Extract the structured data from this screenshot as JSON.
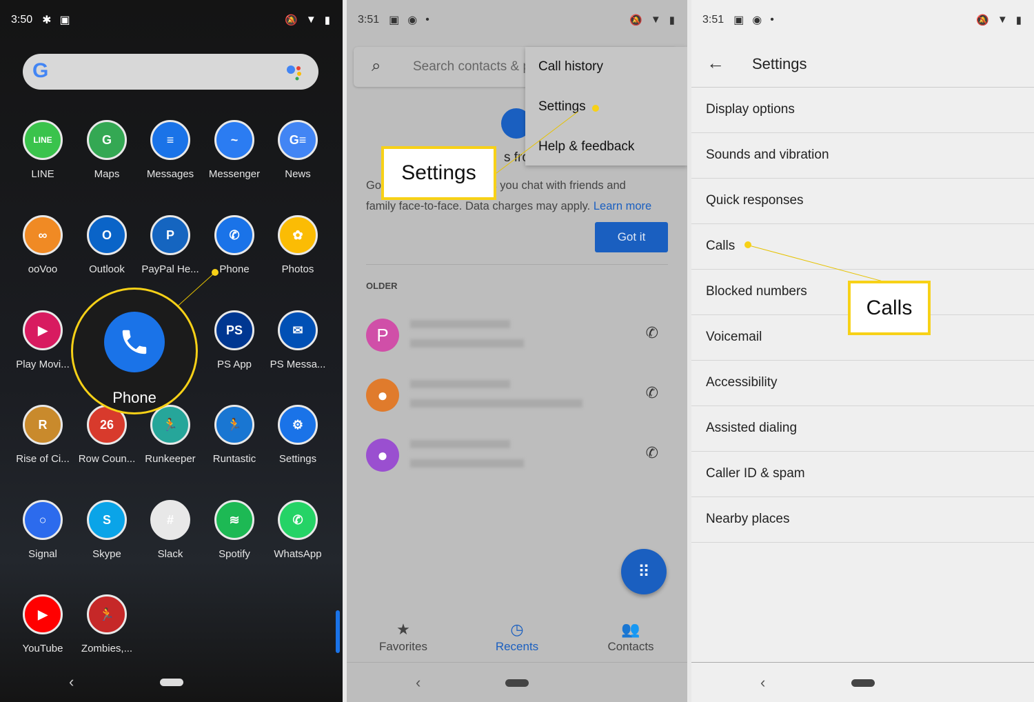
{
  "left": {
    "time": "3:50",
    "status_icons": [
      "slack-icon",
      "screenshot-icon",
      "dnd-off-icon",
      "wifi-icon",
      "battery-icon"
    ],
    "apps": [
      {
        "label": "LINE",
        "color": "#3ac34c",
        "glyph": "LINE"
      },
      {
        "label": "Maps",
        "color": "#34a853",
        "glyph": "G"
      },
      {
        "label": "Messages",
        "color": "#1a73e8",
        "glyph": "≡"
      },
      {
        "label": "Messenger",
        "color": "#2b7cf2",
        "glyph": "~"
      },
      {
        "label": "News",
        "color": "#4285f4",
        "glyph": "G≡"
      },
      {
        "label": "ooVoo",
        "color": "#f08a24",
        "glyph": "∞"
      },
      {
        "label": "Outlook",
        "color": "#0a64c8",
        "glyph": "O"
      },
      {
        "label": "PayPal He...",
        "color": "#1565c0",
        "glyph": "P"
      },
      {
        "label": "Phone",
        "color": "#1a73e8",
        "glyph": "✆"
      },
      {
        "label": "Photos",
        "color": "#fbbc04",
        "glyph": "✿"
      },
      {
        "label": "Play Movi...",
        "color": "#d81b60",
        "glyph": "▶"
      },
      null,
      null,
      {
        "label": "PS App",
        "color": "#003791",
        "glyph": "PS"
      },
      {
        "label": "PS Messa...",
        "color": "#0050b5",
        "glyph": "✉"
      },
      {
        "label": "Rise of Ci...",
        "color": "#c98a2c",
        "glyph": "R"
      },
      {
        "label": "Row Coun...",
        "color": "#d83a2c",
        "glyph": "26"
      },
      {
        "label": "Runkeeper",
        "color": "#26a69a",
        "glyph": "🏃"
      },
      {
        "label": "Runtastic",
        "color": "#1976d2",
        "glyph": "🏃"
      },
      {
        "label": "Settings",
        "color": "#1a73e8",
        "glyph": "⚙"
      },
      {
        "label": "Signal",
        "color": "#2c6bed",
        "glyph": "○"
      },
      {
        "label": "Skype",
        "color": "#0aa4e8",
        "glyph": "S"
      },
      {
        "label": "Slack",
        "color": "#e8e8e8",
        "glyph": "#"
      },
      {
        "label": "Spotify",
        "color": "#1db954",
        "glyph": "≋"
      },
      {
        "label": "WhatsApp",
        "color": "#25d366",
        "glyph": "✆"
      },
      {
        "label": "YouTube",
        "color": "#ff0000",
        "glyph": "▶"
      },
      {
        "label": "Zombies,...",
        "color": "#c62828",
        "glyph": "🏃"
      }
    ],
    "highlight_label": "Phone"
  },
  "middle": {
    "time": "3:51",
    "search_placeholder": "Search contacts & p",
    "menu": [
      "Call history",
      "Settings",
      "Help & feedback"
    ],
    "callout": "Settings",
    "info_line1_start": "Go",
    "info_line1_end": "lets you chat with friends and",
    "info_heading_fragment": "s fro",
    "info_line2": "family face-to-face. Data charges may apply.",
    "learn_more": "Learn more",
    "got_it": "Got it",
    "older": "OLDER",
    "contacts": [
      {
        "initial": "P",
        "color": "#d04fa8"
      },
      {
        "initial": "",
        "color": "#e07b2c"
      },
      {
        "initial": "",
        "color": "#9a4fd0"
      }
    ],
    "nav": [
      {
        "label": "Favorites",
        "icon": "star-icon"
      },
      {
        "label": "Recents",
        "icon": "clock-icon",
        "active": true
      },
      {
        "label": "Contacts",
        "icon": "people-icon"
      }
    ],
    "accent": "#1a5fc0"
  },
  "right": {
    "time": "3:51",
    "title": "Settings",
    "items": [
      "Display options",
      "Sounds and vibration",
      "Quick responses",
      "Calls",
      "Blocked numbers",
      "Voicemail",
      "Accessibility",
      "Assisted dialing",
      "Caller ID & spam",
      "Nearby places"
    ],
    "callout": "Calls"
  },
  "highlight_color": "#f7d117"
}
